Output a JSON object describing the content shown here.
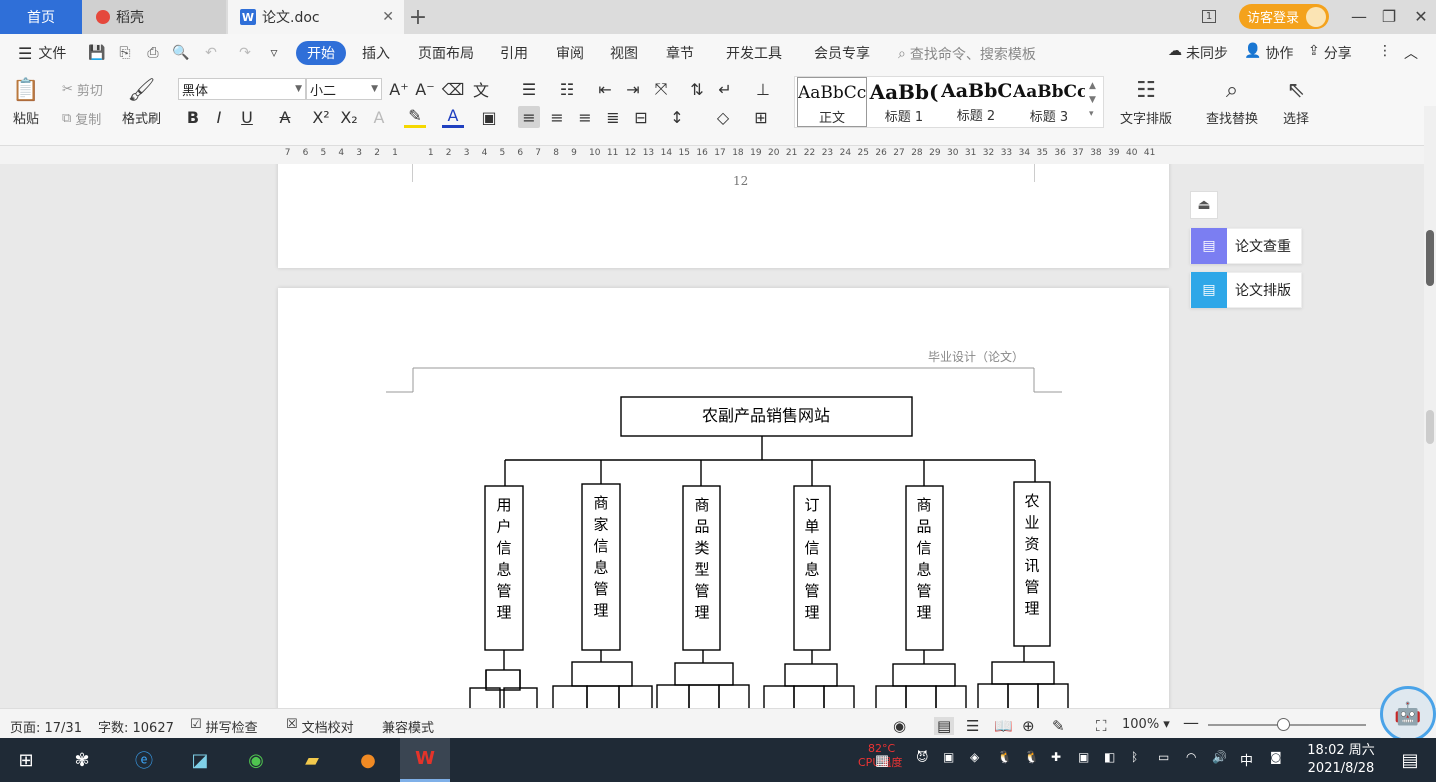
{
  "tabs": {
    "home": "首页",
    "doc1": "稻壳",
    "doc2": "论文.doc",
    "add": "+"
  },
  "title_right": {
    "page_indicator": "1",
    "guest_login": "访客登录"
  },
  "menu": {
    "file": "文件",
    "items": [
      "开始",
      "插入",
      "页面布局",
      "引用",
      "审阅",
      "视图",
      "章节",
      "开发工具",
      "会员专享"
    ],
    "search_placeholder": "查找命令、搜索模板",
    "unsynced": "未同步",
    "collab": "协作",
    "share": "分享"
  },
  "ribbon": {
    "paste": "粘贴",
    "cut": "剪切",
    "copy": "复制",
    "format_painter": "格式刷",
    "font_name": "黑体",
    "font_size": "小二",
    "text_layout": "文字排版",
    "find_replace": "查找替换",
    "select": "选择",
    "styles": [
      {
        "preview": "AaBbCcI",
        "label": "正文"
      },
      {
        "preview": "AaBb(",
        "label": "标题 1"
      },
      {
        "preview": "AaBbC",
        "label": "标题 2"
      },
      {
        "preview": "AaBbCc",
        "label": "标题 3"
      }
    ]
  },
  "ruler": {
    "left_numbers": [
      "7",
      "6",
      "5",
      "4",
      "3",
      "2",
      "1"
    ],
    "right_numbers": [
      "1",
      "2",
      "3",
      "4",
      "5",
      "6",
      "7",
      "8",
      "9",
      "10",
      "11",
      "12",
      "13",
      "14",
      "15",
      "16",
      "17",
      "18",
      "19",
      "20",
      "21",
      "22",
      "23",
      "24",
      "25",
      "26",
      "27",
      "28",
      "29",
      "30",
      "31",
      "32",
      "33",
      "34",
      "35",
      "36",
      "37",
      "38",
      "39",
      "40",
      "41"
    ]
  },
  "document": {
    "page_number": "12",
    "header_text": "毕业设计（论文）",
    "diagram": {
      "root": "农副产品销售网站",
      "modules": [
        "用户信息管理",
        "商家信息管理",
        "商品类型管理",
        "订单信息管理",
        "商品信息管理",
        "农业资讯管理"
      ]
    }
  },
  "side_panel": {
    "check": "论文查重",
    "format": "论文排版"
  },
  "status": {
    "page": "页面: 17/31",
    "words": "字数: 10627",
    "spell": "拼写检查",
    "proof": "文档校对",
    "compat": "兼容模式",
    "zoom": "100%"
  },
  "taskbar": {
    "cpu_temp": "82°C",
    "cpu_label": "CPU温度",
    "ime": "中",
    "time": "18:02 周六",
    "date": "2021/8/28"
  }
}
